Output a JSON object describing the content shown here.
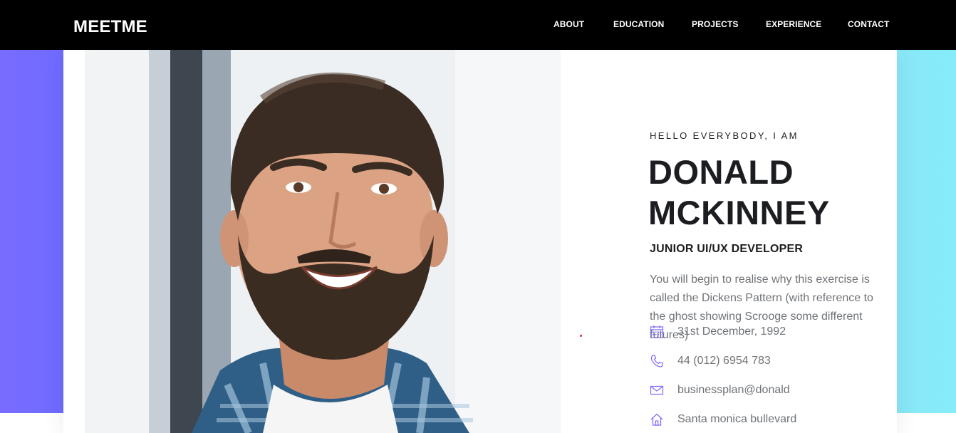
{
  "header": {
    "logo": "MEETME",
    "nav": [
      {
        "label": "ABOUT"
      },
      {
        "label": "EDUCATION"
      },
      {
        "label": "PROJECTS"
      },
      {
        "label": "EXPERIENCE"
      },
      {
        "label": "CONTACT"
      }
    ]
  },
  "profile": {
    "intro": "HELLO EVERYBODY, I AM",
    "name_line1": "DONALD",
    "name_line2": "MCKINNEY",
    "role": "JUNIOR UI/UX DEVELOPER",
    "description": "You will begin to realise why this exercise is called the Dickens Pattern (with reference to the ghost showing Scrooge some different futures)",
    "info": [
      {
        "icon": "calendar-icon",
        "text": "31st December, 1992"
      },
      {
        "icon": "phone-icon",
        "text": "44 (012) 6954 783"
      },
      {
        "icon": "mail-icon",
        "text": "businessplan@donald"
      },
      {
        "icon": "home-icon",
        "text": "Santa monica bullevard"
      }
    ]
  },
  "colors": {
    "accent": "#7a6bff",
    "left_panel": "#7a6bff",
    "right_panel": "#88e9f8",
    "header_bg": "#000000",
    "heading": "#1c1d20",
    "body_text": "#6f7377"
  }
}
